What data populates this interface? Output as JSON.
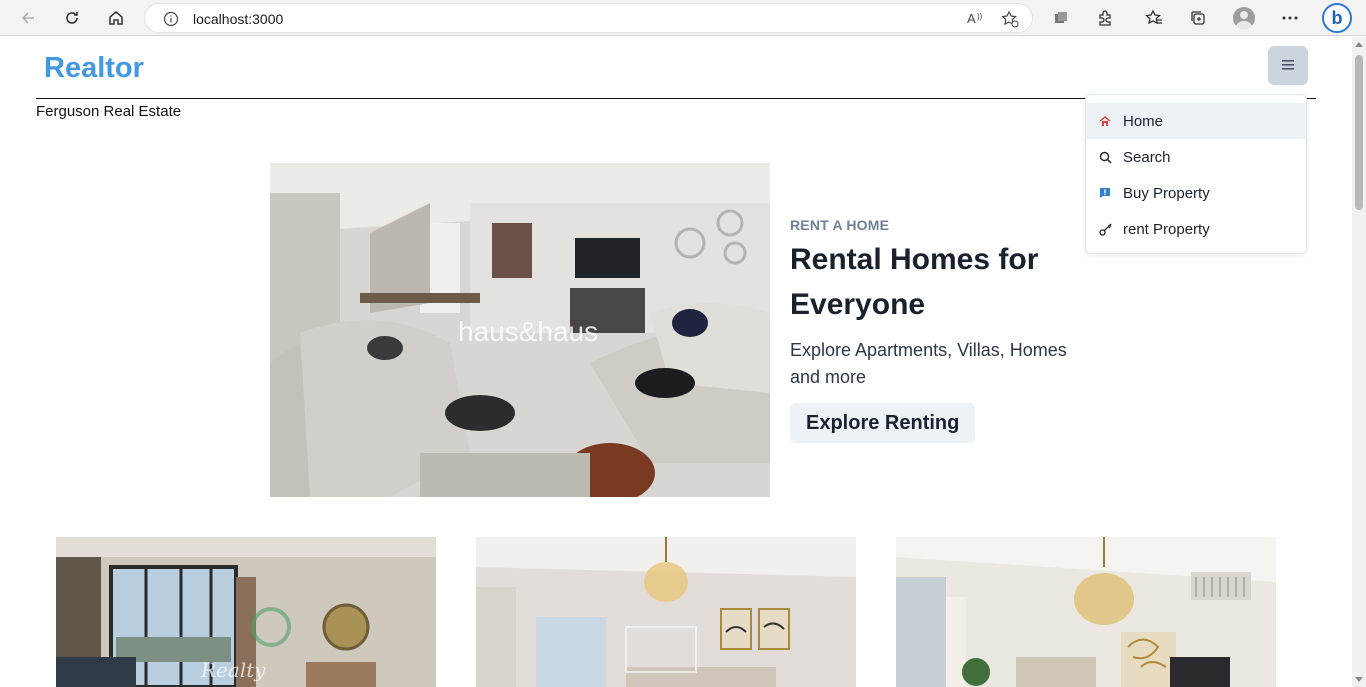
{
  "browser": {
    "url": "localhost:3000",
    "icons": [
      "back-icon",
      "reload-icon",
      "home-icon",
      "info-icon",
      "read-aloud-icon",
      "add-favorite-icon",
      "app-icon",
      "extensions-icon",
      "favorites-icon",
      "collections-icon",
      "profile-icon",
      "more-icon",
      "bing-icon"
    ],
    "bing_label": "b"
  },
  "header": {
    "logo": "Realtor",
    "subtitle": "Ferguson Real Estate"
  },
  "menu": {
    "items": [
      {
        "label": "Home",
        "icon": "home-icon",
        "active": true
      },
      {
        "label": "Search",
        "icon": "search-icon",
        "active": false
      },
      {
        "label": "Buy Property",
        "icon": "store-icon",
        "active": false
      },
      {
        "label": "rent Property",
        "icon": "key-icon",
        "active": false
      }
    ]
  },
  "hero": {
    "label": "RENT A HOME",
    "title": "Rental Homes for Everyone",
    "description": "Explore Apartments, Villas, Homes and more",
    "button": "Explore Renting",
    "image_watermark": "haus&haus"
  },
  "cards": [
    {
      "image_watermark": "Realty"
    },
    {
      "image_watermark": ""
    },
    {
      "image_watermark": ""
    }
  ],
  "colors": {
    "brand": "#4299e1",
    "hamburger_bg": "#cbd5e0",
    "button_bg": "#edf2f7",
    "label_gray": "#718096"
  }
}
